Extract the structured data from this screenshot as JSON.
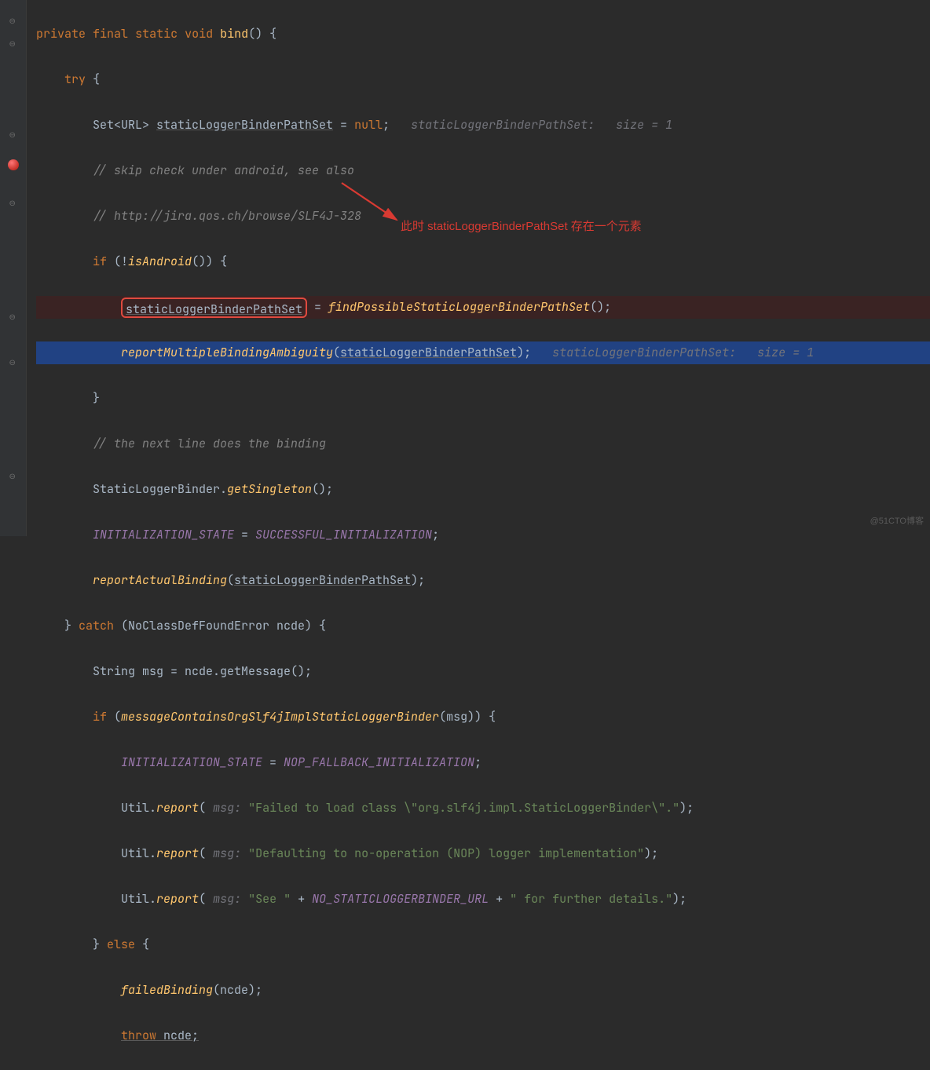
{
  "code": {
    "l1_kw1": "private",
    "l1_kw2": "final",
    "l1_kw3": "static",
    "l1_kw4": "void",
    "l1_method": "bind",
    "l1_rest": "() {",
    "l2_kw": "try",
    "l2_rest": " {",
    "l3_type_a": "Set<URL> ",
    "l3_var": "staticLoggerBinderPathSet",
    "l3_assign": " = ",
    "l3_null": "null",
    "l3_semi": ";   ",
    "l3_hint": "staticLoggerBinderPathSet:   size = 1",
    "l4": "// skip check under android, see also",
    "l5": "// http://jira.qos.ch/browse/SLF4J-328",
    "l6_kw": "if",
    "l6_rest": " (!",
    "l6_call": "isAndroid",
    "l6_tail": "()) {",
    "l7_var": "staticLoggerBinderPathSet",
    "l7_assign": " = ",
    "l7_call": "findPossibleStaticLoggerBinderPathSet",
    "l7_tail": "();",
    "l8_call": "reportMultipleBindingAmbiguity",
    "l8_open": "(",
    "l8_arg": "staticLoggerBinderPathSet",
    "l8_close": ");   ",
    "l8_hint": "staticLoggerBinderPathSet:   size = 1",
    "l9": "}",
    "l10": "// the next line does the binding",
    "l11_a": "StaticLoggerBinder.",
    "l11_call": "getSingleton",
    "l11_tail": "();",
    "l12_a": "INITIALIZATION_STATE",
    "l12_eq": " = ",
    "l12_b": "SUCCESSFUL_INITIALIZATION",
    "l12_semi": ";",
    "l13_call": "reportActualBinding",
    "l13_open": "(",
    "l13_arg": "staticLoggerBinderPathSet",
    "l13_close": ");",
    "l14_a": "} ",
    "l14_kw": "catch",
    "l14_b": " (NoClassDefFoundError ncde) {",
    "l15": "String msg = ncde.getMessage();",
    "l16_kw": "if",
    "l16_a": " (",
    "l16_call": "messageContainsOrgSlf4jImplStaticLoggerBinder",
    "l16_b": "(msg)) {",
    "l17_a": "INITIALIZATION_STATE",
    "l17_eq": " = ",
    "l17_b": "NOP_FALLBACK_INITIALIZATION",
    "l17_semi": ";",
    "l18_a": "Util.",
    "l18_call": "report",
    "l18_open": "( ",
    "l18_param": "msg: ",
    "l18_str": "\"Failed to load class \\\"org.slf4j.impl.StaticLoggerBinder\\\".\"",
    "l18_close": ");",
    "l19_a": "Util.",
    "l19_call": "report",
    "l19_open": "( ",
    "l19_param": "msg: ",
    "l19_str": "\"Defaulting to no-operation (NOP) logger implementation\"",
    "l19_close": ");",
    "l20_a": "Util.",
    "l20_call": "report",
    "l20_open": "( ",
    "l20_param": "msg: ",
    "l20_str1": "\"See \"",
    "l20_plus1": " + ",
    "l20_const": "NO_STATICLOGGERBINDER_URL",
    "l20_plus2": " + ",
    "l20_str2": "\" for further details.\"",
    "l20_close": ");",
    "l21_a": "} ",
    "l21_kw": "else",
    "l21_b": " {",
    "l22_call": "failedBinding",
    "l22_rest": "(ncde);",
    "l23_kw": "throw",
    "l23_rest": " ncde;"
  },
  "annotation": "此时 staticLoggerBinderPathSet 存在一个元素",
  "watermark": "@51CTO博客"
}
